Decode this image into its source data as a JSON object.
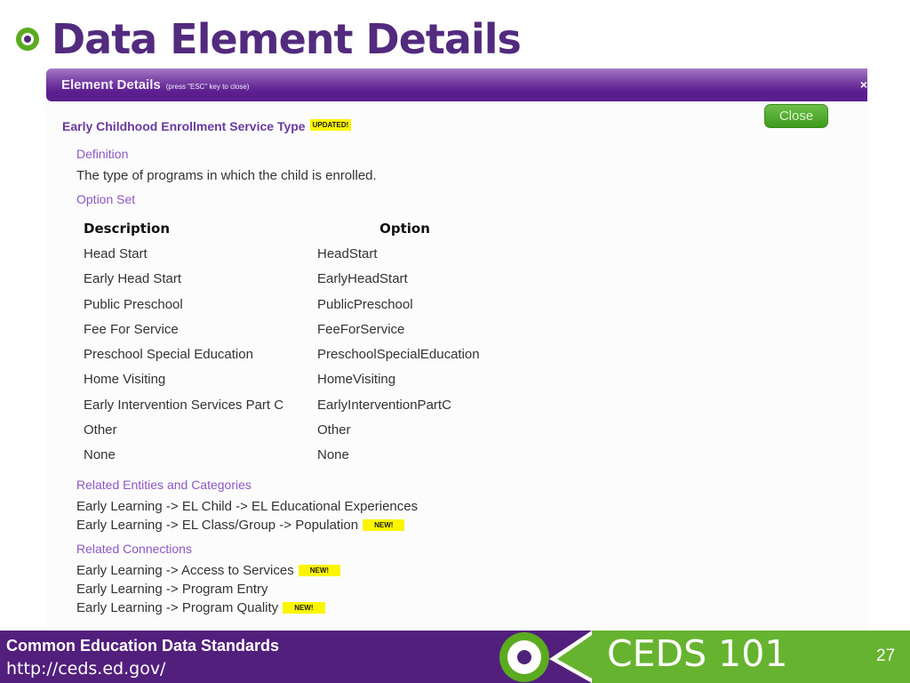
{
  "slide": {
    "title": "Data Element Details",
    "bullet_icon": "target-bullet-icon"
  },
  "popup": {
    "header_title": "Element Details",
    "header_hint": "(press \"ESC\" key to close)",
    "close_x": "×",
    "close_button": "Close",
    "element_name": "Early Childhood Enrollment Service Type",
    "element_badge": "UPDATED!",
    "definition_label": "Definition",
    "definition_text": "The type of programs in which the child is enrolled.",
    "option_set_label": "Option Set",
    "option_table": {
      "headers": [
        "Description",
        "Option"
      ],
      "rows": [
        [
          "Head Start",
          "HeadStart"
        ],
        [
          "Early Head Start",
          "EarlyHeadStart"
        ],
        [
          "Public Preschool",
          "PublicPreschool"
        ],
        [
          "Fee For Service",
          "FeeForService"
        ],
        [
          "Preschool Special Education",
          "PreschoolSpecialEducation"
        ],
        [
          "Home Visiting",
          "HomeVisiting"
        ],
        [
          "Early Intervention Services Part C",
          "EarlyInterventionPartC"
        ],
        [
          "Other",
          "Other"
        ],
        [
          "None",
          "None"
        ]
      ]
    },
    "related_entities_label": "Related Entities and Categories",
    "related_entities": [
      {
        "text": "Early Learning -> EL Child -> EL Educational Experiences",
        "badge": ""
      },
      {
        "text": "Early Learning -> EL Class/Group -> Population",
        "badge": "NEW!"
      }
    ],
    "related_connections_label": "Related Connections",
    "related_connections": [
      {
        "text": "Early Learning -> Access to Services",
        "badge": "NEW!"
      },
      {
        "text": "Early Learning -> Program Entry",
        "badge": ""
      },
      {
        "text": "Early Learning -> Program Quality",
        "badge": "NEW!"
      }
    ]
  },
  "footer": {
    "org_name": "Common Education Data Standards",
    "url": "http://ceds.ed.gov/",
    "course": "CEDS 101",
    "page_number": "27"
  },
  "colors": {
    "title_purple": "#522b7e",
    "accent_green": "#65b32e",
    "footer_purple": "#531f7c",
    "badge_yellow": "#fbf600",
    "label_purple": "#8e57c4"
  }
}
